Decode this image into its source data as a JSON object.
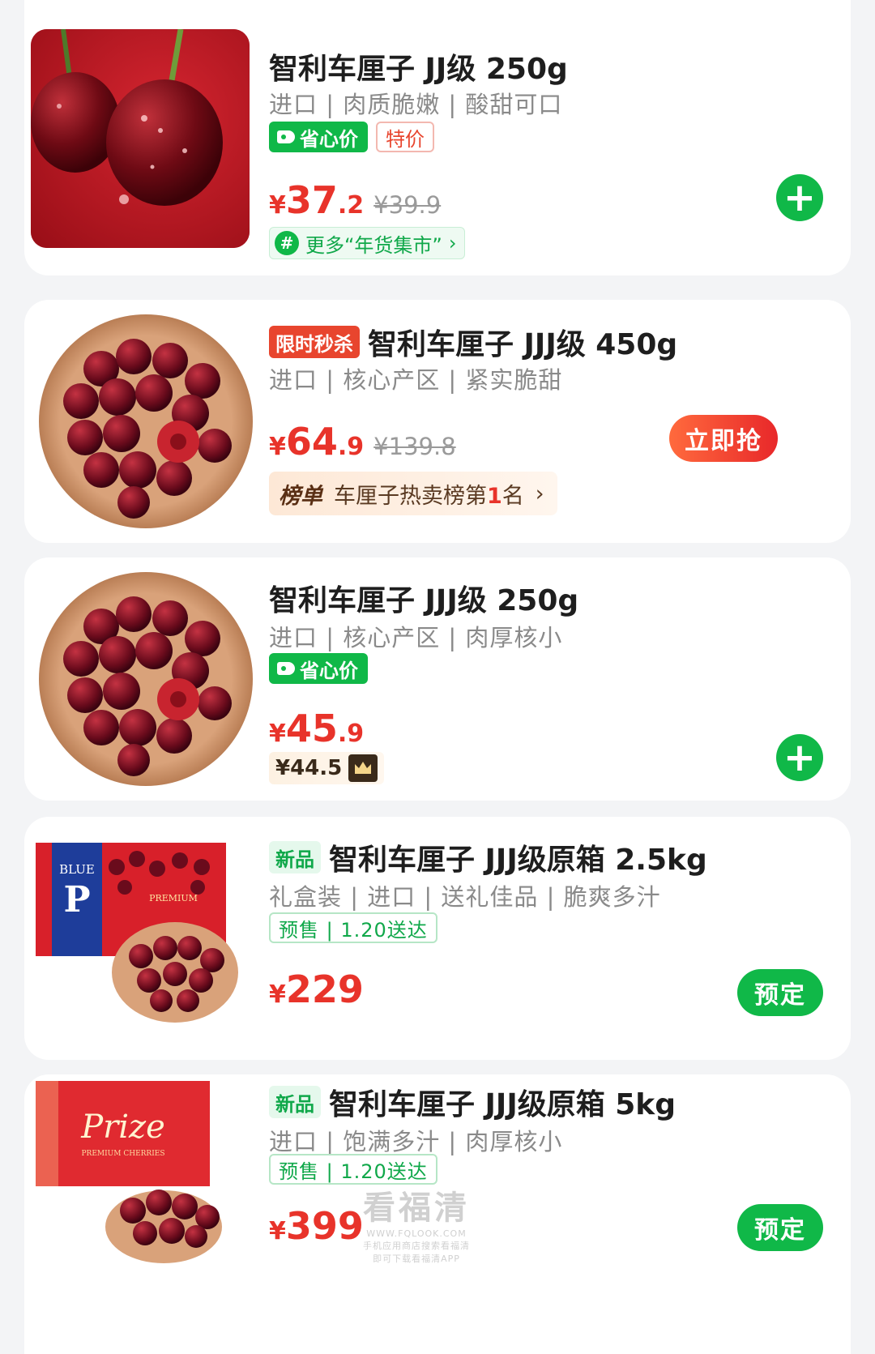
{
  "products": [
    {
      "title": "智利车厘子 JJ级 250g",
      "sub": "进口 | 肉质脆嫩 | 酸甜可口",
      "tags": [
        "省心价",
        "特价"
      ],
      "price_int": "37",
      "price_dec": ".2",
      "price_orig": "¥39.9",
      "link": "更多“年货集市”",
      "action": "plus"
    },
    {
      "flash_tag": "限时秒杀",
      "title": "智利车厘子 JJJ级 450g",
      "sub": "进口 | 核心产区 | 紧实脆甜",
      "price_int": "64",
      "price_dec": ".9",
      "price_orig": "¥139.8",
      "rank_label": "榜单",
      "rank_text_a": "车厘子热卖榜第",
      "rank_num": "1",
      "rank_text_b": "名",
      "action_label": "立即抢"
    },
    {
      "title": "智利车厘子 JJJ级 250g",
      "sub": "进口 | 核心产区 | 肉厚核小",
      "tags": [
        "省心价"
      ],
      "price_int": "45",
      "price_dec": ".9",
      "member_price": "¥44.5",
      "action": "plus"
    },
    {
      "new_tag": "新品",
      "title": "智利车厘子 JJJ级原箱 2.5kg",
      "sub": "礼盒装 | 进口 | 送礼佳品 | 脆爽多汁",
      "presale": "预售 | 1.20送达",
      "price_int": "229",
      "action_label": "预定",
      "box_brand_a": "BLUE",
      "box_brand_b": "P",
      "box_brand_c": "PREMIUM"
    },
    {
      "new_tag": "新品",
      "title": "智利车厘子 JJJ级原箱 5kg",
      "sub": "进口 | 饱满多汁 | 肉厚核小",
      "presale": "预售 | 1.20送达",
      "price_int": "399",
      "action_label": "预定",
      "box_brand_a": "Prize",
      "box_brand_b": "PREMIUM CHERRIES"
    }
  ],
  "currency": "¥",
  "plus_symbol": "+",
  "chevron": "›",
  "hash_symbol": "#",
  "watermark": {
    "main": "看福清",
    "sub_a": "WWW.FQLOOK.COM",
    "sub_b": "手机应用商店搜索看福清",
    "sub_c": "即可下载看福清APP"
  },
  "colors": {
    "price_red": "#e8332a",
    "brand_green": "#10b848",
    "flash_red": "#e8452e"
  }
}
